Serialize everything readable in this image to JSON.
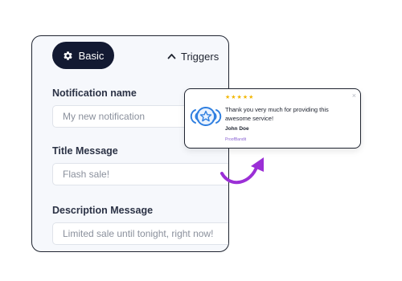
{
  "tabs": {
    "basic_label": "Basic",
    "triggers_label": "Triggers",
    "basic_icon": "gear-icon",
    "triggers_icon": "chevron-up-icon",
    "active_color": "#131a32"
  },
  "fields": {
    "notification_name": {
      "label": "Notification name",
      "placeholder": "My new notification"
    },
    "title_message": {
      "label": "Title Message",
      "value": "Flash sale!"
    },
    "description_message": {
      "label": "Description Message",
      "value": "Limited sale until tonight, right now!"
    }
  },
  "preview": {
    "stars": "★★★★★",
    "rating": 5,
    "message": "Thank you very much for providing this awesome service!",
    "author": "John Doe",
    "brand": "ProofBandit",
    "close_label": "×",
    "star_color": "#f2b705",
    "brand_color": "#8a63d2",
    "logo_color": "#2f7fe0"
  },
  "arrow_color": "#9b2fd6"
}
